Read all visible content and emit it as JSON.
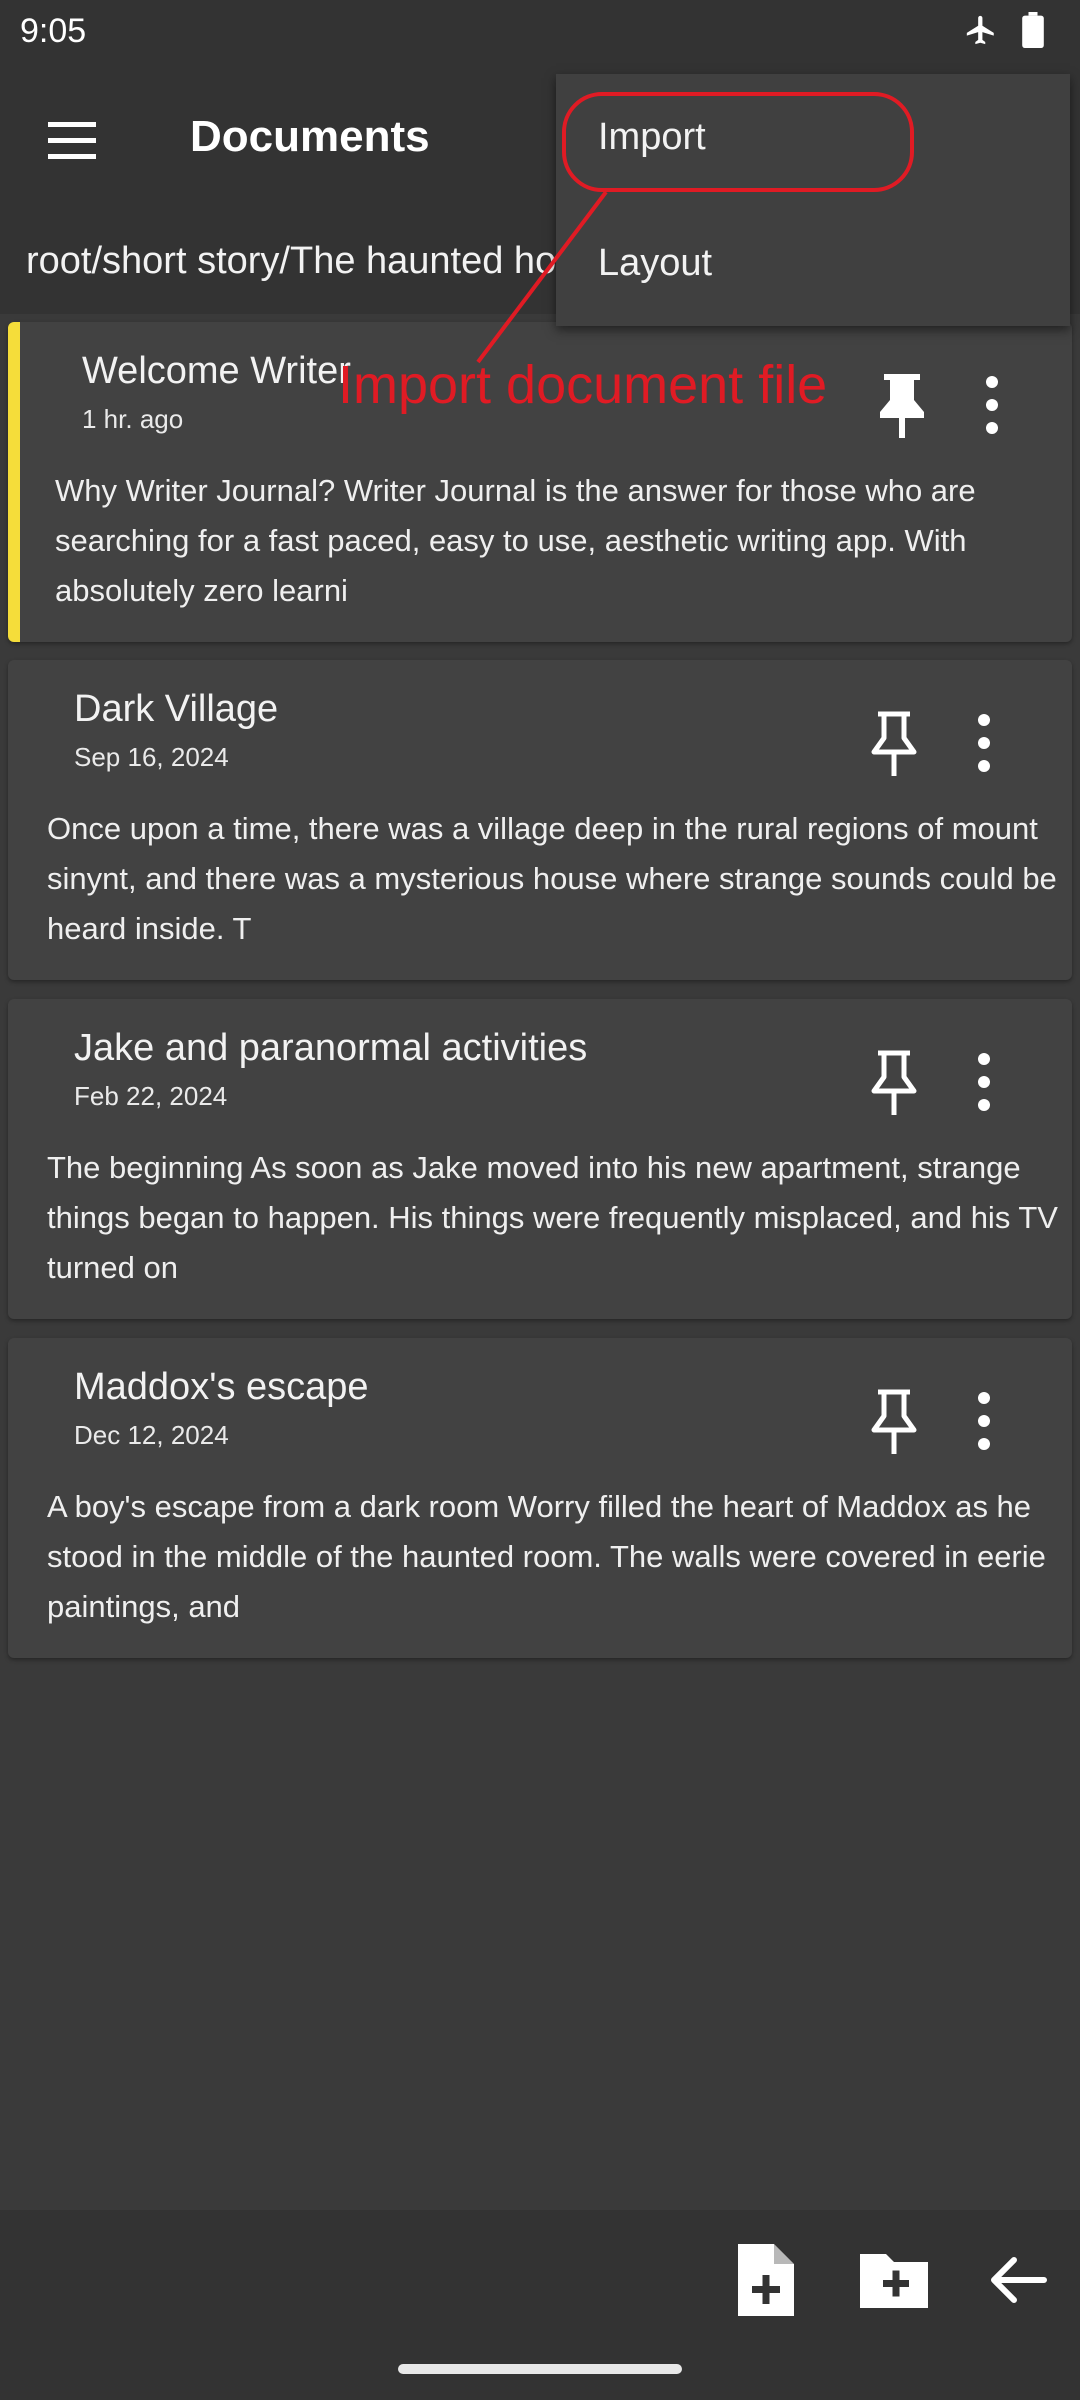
{
  "status": {
    "time": "9:05"
  },
  "appbar": {
    "title": "Documents"
  },
  "path": {
    "text": "root/short story/The haunted house"
  },
  "menu": {
    "items": [
      {
        "label": "Import"
      },
      {
        "label": "Layout"
      }
    ]
  },
  "annotation": {
    "text": "Import document file",
    "color": "#e01b24"
  },
  "documents": [
    {
      "title": "Welcome Writer",
      "date": "1 hr. ago",
      "preview": "Why Writer Journal? Writer Journal is the answer for those who are searching for a fast paced, easy to use, aesthetic writing app. With absolutely zero learni",
      "pinned": true,
      "accent": "#f5dd3a"
    },
    {
      "title": "Dark Village",
      "date": "Sep 16, 2024",
      "preview": "Once upon a time, there was a village deep in the rural regions of mount sinynt, and there was a mysterious house where strange sounds could be heard inside. T",
      "pinned": false
    },
    {
      "title": "Jake and paranormal activities",
      "date": "Feb 22, 2024",
      "preview": " The beginning As soon as Jake moved into his new apartment, strange things began to happen. His things were frequently misplaced, and his TV turned on",
      "pinned": false
    },
    {
      "title": "Maddox's escape",
      "date": "Dec 12, 2024",
      "preview": "A boy's escape from a dark room Worry filled the heart of Maddox as he stood in the middle of the haunted room. The walls were covered in eerie paintings, and",
      "pinned": false
    }
  ],
  "icons": {
    "menu": "hamburger-menu-icon",
    "pin": "pin-icon",
    "more": "more-vert-icon",
    "new_document": "note-add-icon",
    "new_folder": "create-new-folder-icon",
    "back": "arrow-back-icon",
    "airplane": "airplane-mode-icon",
    "battery": "battery-icon"
  }
}
